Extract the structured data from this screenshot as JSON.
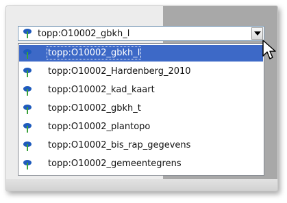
{
  "combo": {
    "selected_value": "topp:O10002_gbkh_l",
    "icon": "layer-pin-icon",
    "button_icon": "chevron-down-icon"
  },
  "options": [
    {
      "label": "topp:O10002_gbkh_l",
      "selected": true
    },
    {
      "label": "topp:O10002_Hardenberg_2010",
      "selected": false
    },
    {
      "label": "topp:O10002_kad_kaart",
      "selected": false
    },
    {
      "label": "topp:O10002_gbkh_t",
      "selected": false
    },
    {
      "label": "topp:O10002_plantopo",
      "selected": false
    },
    {
      "label": "topp:O10002_bis_rap_gegevens",
      "selected": false
    },
    {
      "label": "topp:O10002_gemeentegrens",
      "selected": false
    }
  ],
  "colors": {
    "selection": "#3d69c7",
    "icon_blue": "#1f5bbd",
    "icon_green": "#3aa13a"
  }
}
